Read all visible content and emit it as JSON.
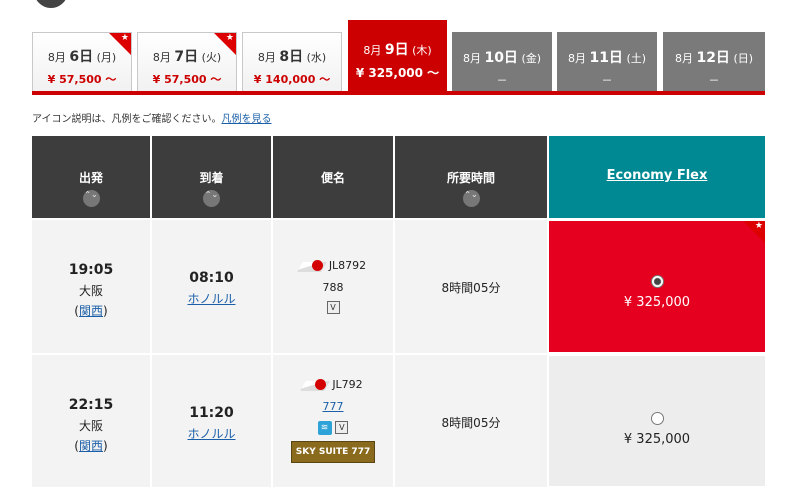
{
  "date_tabs": [
    {
      "month": "8月",
      "day": "6日",
      "dow": "(月)",
      "price": "¥ 57,500 ～",
      "star": true,
      "state": "normal"
    },
    {
      "month": "8月",
      "day": "7日",
      "dow": "(火)",
      "price": "¥ 57,500 ～",
      "star": true,
      "state": "normal"
    },
    {
      "month": "8月",
      "day": "8日",
      "dow": "(水)",
      "price": "¥ 140,000 ～",
      "star": false,
      "state": "normal"
    },
    {
      "month": "8月",
      "day": "9日",
      "dow": "(木)",
      "price": "¥ 325,000 ～",
      "star": false,
      "state": "active"
    },
    {
      "month": "8月",
      "day": "10日",
      "dow": "(金)",
      "price": "－",
      "star": false,
      "state": "disabled"
    },
    {
      "month": "8月",
      "day": "11日",
      "dow": "(土)",
      "price": "－",
      "star": false,
      "state": "disabled"
    },
    {
      "month": "8月",
      "day": "12日",
      "dow": "(日)",
      "price": "－",
      "star": false,
      "state": "disabled"
    }
  ],
  "star_glyph": "★",
  "note": {
    "text": "アイコン説明は、凡例をご確認ください。",
    "link": "凡例を見る"
  },
  "headers": {
    "depart": "出発",
    "arrive": "到着",
    "flight": "便名",
    "duration": "所要時間",
    "fare": "Economy Flex",
    "sort_glyph": "⌃⌄"
  },
  "flights": [
    {
      "dep_time": "19:05",
      "dep_city": "大阪",
      "dep_airport_open": "(",
      "dep_airport": "関西",
      "dep_airport_close": ")",
      "arr_time": "08:10",
      "arr_city": "ホノルル",
      "flight_no": "JL8792",
      "aircraft": "788",
      "icons": [
        "V"
      ],
      "sky_suite": "",
      "duration": "8時間05分",
      "price": "¥ 325,000",
      "selected": true
    },
    {
      "dep_time": "22:15",
      "dep_city": "大阪",
      "dep_airport_open": "(",
      "dep_airport": "関西",
      "dep_airport_close": ")",
      "arr_time": "11:20",
      "arr_city": "ホノルル",
      "flight_no": "JL792",
      "aircraft": "777",
      "icons": [
        "wifi",
        "V"
      ],
      "sky_suite": "SKY SUITE 777",
      "duration": "8時間05分",
      "price": "¥ 325,000",
      "selected": false
    }
  ],
  "colors": {
    "active_red": "#cc0000",
    "fare_teal": "#008993",
    "selected_fare": "#e60020",
    "header_dark": "#3d3d3d"
  }
}
